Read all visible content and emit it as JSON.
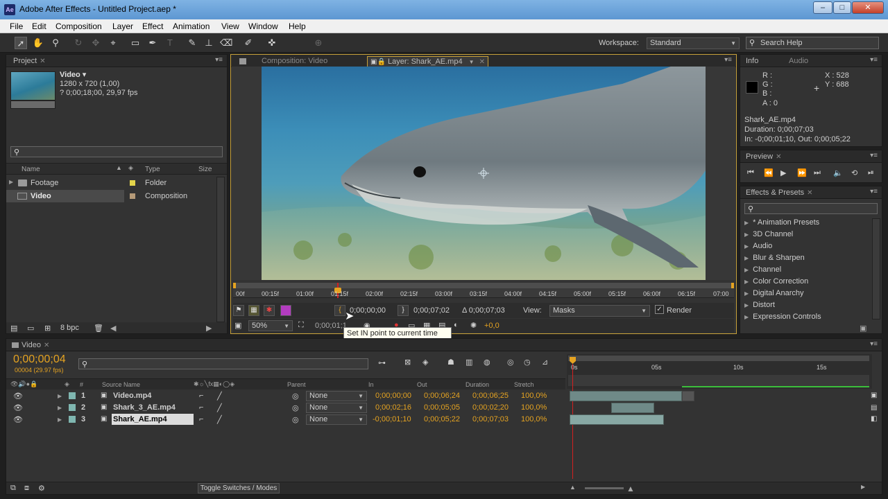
{
  "window": {
    "title": "Adobe After Effects - Untitled Project.aep *",
    "logo": "Ae",
    "min": "‒",
    "max": "□",
    "close": "✕"
  },
  "menu": [
    "File",
    "Edit",
    "Composition",
    "Layer",
    "Effect",
    "Animation",
    "View",
    "Window",
    "Help"
  ],
  "toolbar": {
    "workspace_label": "Workspace:",
    "workspace_value": "Standard",
    "search_placeholder": "Search Help"
  },
  "project": {
    "tab": "Project",
    "item_name": "Video ▾",
    "item_res": "1280 x 720 (1,00)",
    "item_dur": "? 0;00;18;00, 29,97 fps",
    "columns": {
      "name": "Name",
      "type": "Type",
      "size": "Size"
    },
    "rows": [
      {
        "name": "Footage",
        "type": "Folder",
        "color": "#e3d44a"
      },
      {
        "name": "Video",
        "type": "Composition",
        "color": "#b59a78"
      }
    ],
    "bpc": "8 bpc"
  },
  "viewer": {
    "tab_comp": "Composition: Video",
    "tab_layer": "Layer: Shark_AE.mp4",
    "ruler": [
      "00f",
      "00:15f",
      "01:00f",
      "01:15f",
      "02:00f",
      "02:15f",
      "03:00f",
      "03:15f",
      "04:00f",
      "04:15f",
      "05:00f",
      "05:15f",
      "06:00f",
      "06:15f",
      "07:00"
    ],
    "in_time": "0;00;00;00",
    "out_time": "0;00;07;02",
    "delta": "Δ 0;00;07;03",
    "view_label": "View:",
    "view_value": "Masks",
    "render_label": "Render",
    "zoom": "50%",
    "cur_time": "0;00;01;1",
    "offset": "+0,0"
  },
  "tooltip": "Set IN point to current time",
  "info": {
    "tab": "Info",
    "tab2": "Audio",
    "r": "R :",
    "g": "G :",
    "b": "B :",
    "a": "A : 0",
    "x": "X : 528",
    "y": "Y : 688",
    "file": "Shark_AE.mp4",
    "duration": "Duration: 0;00;07;03",
    "inout": "In: -0;00;01;10, Out: 0;00;05;22"
  },
  "preview": {
    "tab": "Preview"
  },
  "effects": {
    "tab": "Effects & Presets",
    "items": [
      "* Animation Presets",
      "3D Channel",
      "Audio",
      "Blur & Sharpen",
      "Channel",
      "Color Correction",
      "Digital Anarchy",
      "Distort",
      "Expression Controls"
    ]
  },
  "timeline": {
    "tab": "Video",
    "timecode": "0;00;00;04",
    "frames": "00004 (29.97 fps)",
    "col_num": "#",
    "col_source": "Source Name",
    "col_parent": "Parent",
    "col_in": "In",
    "col_out": "Out",
    "col_duration": "Duration",
    "col_stretch": "Stretch",
    "ruler": [
      "0s",
      "05s",
      "10s",
      "15s"
    ],
    "layers": [
      {
        "num": "1",
        "name": "Video.mp4",
        "parent": "None",
        "in": "0;00;00;00",
        "out": "0;00;06;24",
        "duration": "0;00;06;25",
        "stretch": "100,0%"
      },
      {
        "num": "2",
        "name": "Shark_3_AE.mp4",
        "parent": "None",
        "in": "0;00;02;16",
        "out": "0;00;05;05",
        "duration": "0;00;02;20",
        "stretch": "100,0%"
      },
      {
        "num": "3",
        "name": "Shark_AE.mp4",
        "parent": "None",
        "in": "-0;00;01;10",
        "out": "0;00;05;22",
        "duration": "0;00;07;03",
        "stretch": "100,0%"
      }
    ],
    "toggle": "Toggle Switches / Modes"
  }
}
